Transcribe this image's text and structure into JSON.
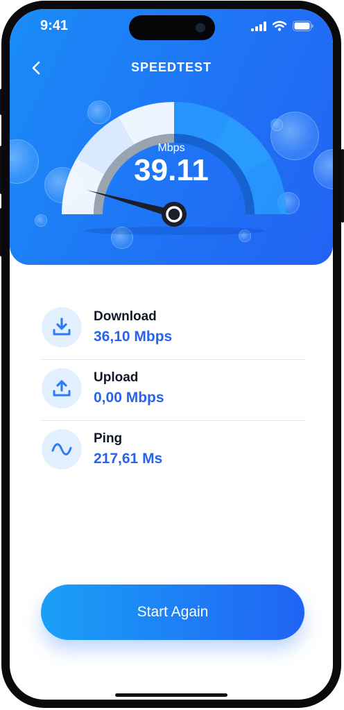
{
  "status_bar": {
    "time": "9:41",
    "signal_icon": "cellular-signal-icon",
    "wifi_icon": "wifi-icon",
    "battery_icon": "battery-icon"
  },
  "header": {
    "back_icon": "chevron-left-icon",
    "title": "SPEEDTEST"
  },
  "gauge": {
    "unit": "Mbps",
    "value": "39.11",
    "level_fraction": 0.5,
    "colors": {
      "filled": "#ffffff",
      "remaining": "#2aa0ff",
      "inner_track_left": "#9aa3b0",
      "inner_track_right": "#1562d0",
      "needle": "#1a1f2b"
    }
  },
  "stats": [
    {
      "icon": "download-icon",
      "label": "Download",
      "value": "36,10 Mbps"
    },
    {
      "icon": "upload-icon",
      "label": "Upload",
      "value": "0,00 Mbps"
    },
    {
      "icon": "wave-icon",
      "label": "Ping",
      "value": "217,61 Ms"
    }
  ],
  "actions": {
    "start_again": "Start Again"
  },
  "colors": {
    "accent": "#2763f0",
    "hero_start": "#1a8cf7",
    "hero_end": "#2262f4",
    "icon_bg": "#e1efff"
  }
}
